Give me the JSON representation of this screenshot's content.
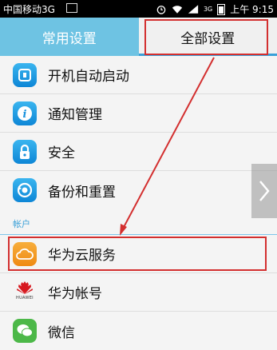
{
  "status_bar": {
    "carrier": "中国移动3G",
    "time": "上午 9:15",
    "signal_badge": "3G",
    "icons": [
      "image-icon",
      "alarm-icon",
      "wifi-icon",
      "signal-icon",
      "battery-icon"
    ]
  },
  "tabs": [
    {
      "label": "常用设置",
      "selected": false
    },
    {
      "label": "全部设置",
      "selected": true
    }
  ],
  "settings": {
    "items": [
      {
        "label": "开机自动启动",
        "icon": "power-on-icon"
      },
      {
        "label": "通知管理",
        "icon": "info-icon"
      },
      {
        "label": "安全",
        "icon": "lock-icon"
      },
      {
        "label": "备份和重置",
        "icon": "backup-icon"
      }
    ],
    "section_account": "帐户",
    "account_items": [
      {
        "label": "华为云服务",
        "icon": "cloud-icon"
      },
      {
        "label": "华为帐号",
        "icon": "huawei-logo-icon",
        "logo_text": "HUAWEI"
      },
      {
        "label": "微信",
        "icon": "wechat-icon"
      }
    ]
  },
  "colors": {
    "tab_active_bg": "#6ec3e3",
    "accent": "#3aa0d8",
    "annotation_red": "#d32f2f",
    "cloud_orange": "#f39a1e",
    "wechat_green": "#4cb848",
    "huawei_red": "#d71920"
  }
}
